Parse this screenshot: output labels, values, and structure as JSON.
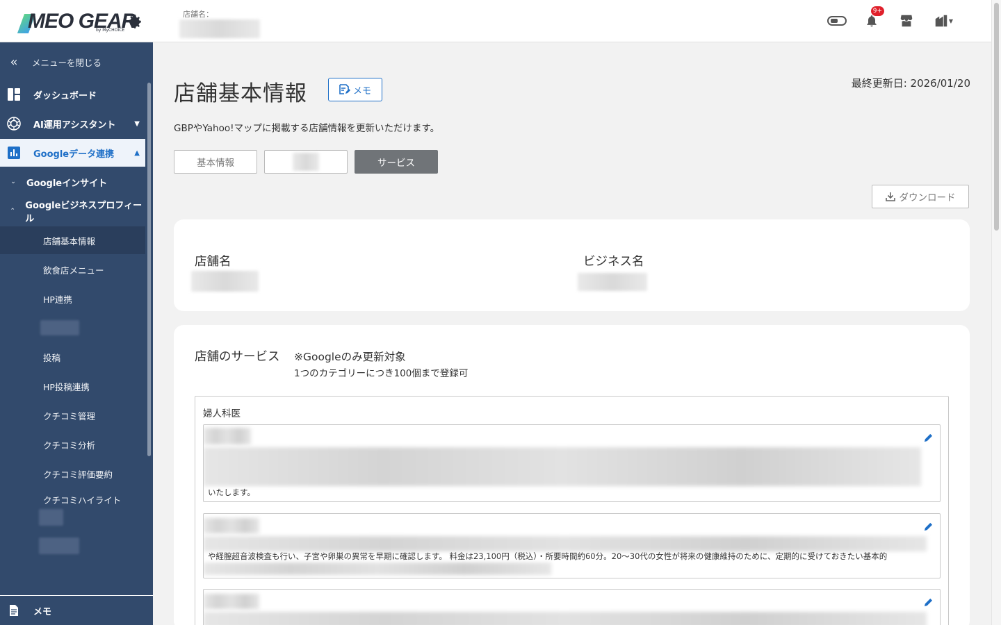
{
  "header": {
    "logo_text": "MEO GEAR",
    "logo_sub": "by MyCHOICE",
    "store_label": "店舗名：",
    "notification_count": "9+"
  },
  "sidebar": {
    "close_label": "メニューを閉じる",
    "items": [
      {
        "label": "ダッシュボード",
        "icon": "dashboard-icon"
      },
      {
        "label": "AI運用アシスタント",
        "icon": "openai-icon"
      },
      {
        "label": "Googleデータ連携",
        "icon": "bar-chart-icon"
      },
      {
        "label": "Googleインサイト"
      },
      {
        "label": "Googleビジネスプロフィール"
      }
    ],
    "sub_items": [
      "店舗基本情報",
      "飲食店メニュー",
      "HP連携",
      "投稿",
      "HP投稿連携",
      "クチコミ管理",
      "クチコミ分析",
      "クチコミ評価要約",
      "クチコミハイライト"
    ],
    "bottom_label": "メモ"
  },
  "main": {
    "title": "店舗基本情報",
    "memo_label": "メモ",
    "updated": "最終更新日: 2026/01/20",
    "description": "GBPやYahoo!マップに掲載する店舗情報を更新いただけます。",
    "tabs": [
      "基本情報",
      "",
      "サービス"
    ],
    "download_label": "ダウンロード",
    "store_name_label": "店舗名",
    "business_name_label": "ビジネス名",
    "services_title": "店舗のサービス",
    "services_note": "※Googleのみ更新対象",
    "services_note2": "1つのカテゴリーにつき100個まで登録可",
    "category": "婦人科医",
    "service1_text": "いたします。",
    "service2_text": "や経膣超音波検査も行い、子宮や卵巣の異常を早期に確認します。 料金は23,100円（税込）・所要時間約60分。20〜30代の女性が将来の健康維持のために、定期的に受けておきたい基本的"
  },
  "colors": {
    "sidebar_bg": "#324a6c",
    "accent": "#1e6fc7",
    "badge": "#e0202b"
  }
}
